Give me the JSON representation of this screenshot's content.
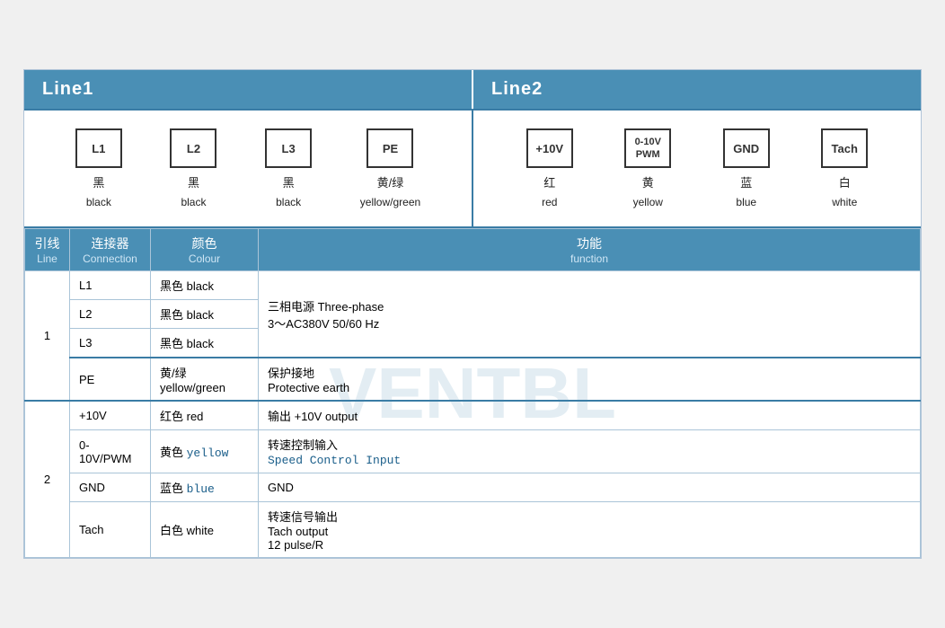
{
  "header": {
    "line1_label": "Line1",
    "line2_label": "Line2"
  },
  "line1_connectors": [
    {
      "id": "conn-L1",
      "box_label": "L1",
      "cn": "黑",
      "en": "black"
    },
    {
      "id": "conn-L2",
      "box_label": "L2",
      "cn": "黑",
      "en": "black"
    },
    {
      "id": "conn-L3",
      "box_label": "L3",
      "cn": "黑",
      "en": "black"
    },
    {
      "id": "conn-PE",
      "box_label": "PE",
      "cn": "黄/绿",
      "en": "yellow/green"
    }
  ],
  "line2_connectors": [
    {
      "id": "conn-10V",
      "box_label": "+10V",
      "cn": "红",
      "en": "red"
    },
    {
      "id": "conn-PWM",
      "box_label": "0-10V\nPWM",
      "cn": "黄",
      "en": "yellow"
    },
    {
      "id": "conn-GND",
      "box_label": "GND",
      "cn": "蓝",
      "en": "blue"
    },
    {
      "id": "conn-Tach",
      "box_label": "Tach",
      "cn": "白",
      "en": "white"
    }
  ],
  "table": {
    "headers": [
      {
        "cn": "引线",
        "en": "Line"
      },
      {
        "cn": "连接器",
        "en": "Connection"
      },
      {
        "cn": "颜色",
        "en": "Colour"
      },
      {
        "cn": "功能",
        "en": "function"
      }
    ],
    "rows": [
      {
        "line": "1",
        "line_rowspan": 4,
        "connection": "L1",
        "color": "黑色 black",
        "function": "三相电源 Three-phase\n3～AC380V 50/60 Hz",
        "func_rowspan": 3
      },
      {
        "connection": "L2",
        "color": "黑色 black",
        "function": null
      },
      {
        "connection": "L3",
        "color": "黑色 black",
        "function": null
      },
      {
        "connection": "PE",
        "color": "黄/绿\nyellow/green",
        "function": "保护接地\nProtective earth",
        "func_rowspan": 1,
        "row_top_border": true
      }
    ],
    "rows2": [
      {
        "line": "2",
        "line_rowspan": 4,
        "connection": "+10V",
        "color": "红色 red",
        "function": "输出 +10V output",
        "row_top_border": true
      },
      {
        "connection": "0-10V/PWM",
        "color_cn": "黄色",
        "color_en": "yellow",
        "function_cn": "转速控制输入",
        "function_en": "Speed Control Input",
        "is_mono": true
      },
      {
        "connection": "GND",
        "color_cn": "蓝色",
        "color_en": "blue",
        "function": "GND"
      },
      {
        "connection": "Tach",
        "color": "白色 white",
        "function": "转速信号输出\nTach output\n12 pulse/R"
      }
    ]
  }
}
